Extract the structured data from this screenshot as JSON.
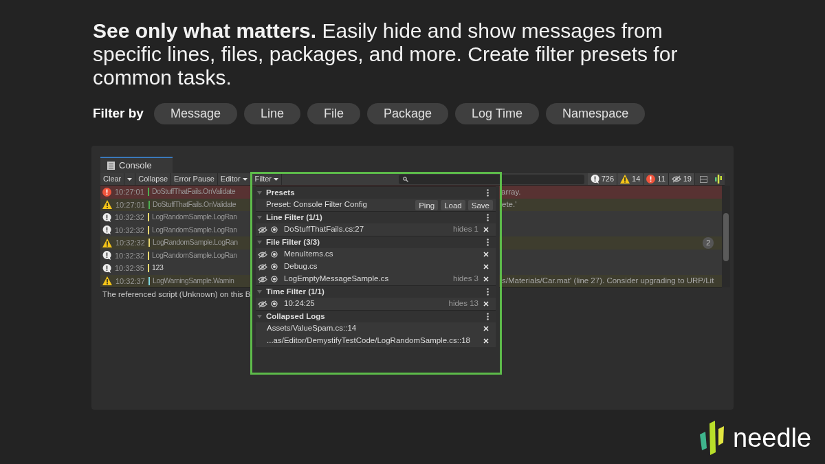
{
  "headline": "**See only what matters.** Easily hide and show messages from specific lines, files, packages, and more. Create filter presets for common tasks.",
  "filter_by": {
    "label": "Filter by",
    "chips": [
      "Message",
      "Line",
      "File",
      "Package",
      "Log Time",
      "Namespace"
    ]
  },
  "console": {
    "tab": "Console",
    "toolbar": {
      "buttons": [
        "Clear",
        "Collapse",
        "Error Pause",
        "Editor"
      ],
      "filter": "Filter",
      "counters": [
        {
          "kind": "info",
          "count": "726"
        },
        {
          "kind": "warning",
          "count": "14"
        },
        {
          "kind": "error",
          "count": "11"
        },
        {
          "kind": "hidden",
          "count": "19"
        }
      ]
    },
    "rows": [
      {
        "kind": "error",
        "time": "10:27:01",
        "color": "#4caf50",
        "message": "DoStuffThatFails.OnValidate",
        "tail": "array."
      },
      {
        "kind": "warning",
        "time": "10:27:01",
        "color": "#4caf50",
        "message": "DoStuffThatFails.OnValidate",
        "tail": "ete.'"
      },
      {
        "kind": "info",
        "time": "10:32:32",
        "color": "#e8d870",
        "message": "LogRandomSample.LogRan"
      },
      {
        "kind": "info",
        "time": "10:32:32",
        "color": "#e8d870",
        "message": "LogRandomSample.LogRan"
      },
      {
        "kind": "warning",
        "time": "10:32:32",
        "color": "#e8d870",
        "message": "LogRandomSample.LogRan",
        "badge": "2"
      },
      {
        "kind": "info",
        "time": "10:32:32",
        "color": "#e8d870",
        "message": "LogRandomSample.LogRan"
      },
      {
        "kind": "info",
        "time": "10:32:35",
        "color": "#e8d870",
        "message": "123"
      },
      {
        "kind": "warning",
        "time": "10:32:37",
        "color": "#7fd8e0",
        "message": "LogWarningSample.Warnin",
        "tail": "s/Materials/Car.mat' (line 27). Consider upgrading to URP/Lit"
      }
    ],
    "detail": "The referenced script (Unknown) on this B",
    "filter_popup": {
      "sections": [
        {
          "kind": "preset",
          "title": "Presets",
          "preset": "Preset: Console Filter Config",
          "buttons": [
            "Ping",
            "Load",
            "Save"
          ]
        },
        {
          "kind": "filter",
          "title": "Line Filter (1/1)",
          "items": [
            {
              "label": "DoStuffThatFails.cs:27",
              "hides": "hides 1"
            }
          ]
        },
        {
          "kind": "filter",
          "title": "File Filter (3/3)",
          "items": [
            {
              "label": "MenuItems.cs"
            },
            {
              "label": "Debug.cs"
            },
            {
              "label": "LogEmptyMessageSample.cs",
              "hides": "hides 3"
            }
          ]
        },
        {
          "kind": "filter",
          "title": "Time Filter (1/1)",
          "items": [
            {
              "label": "10:24:25",
              "hides": "hides 13"
            }
          ]
        },
        {
          "kind": "collapsed",
          "title": "Collapsed Logs",
          "items": [
            {
              "label": "Assets/ValueSpam.cs::14"
            },
            {
              "label": "...as/Editor/DemystifyTestCode/LogRandomSample.cs::18"
            }
          ]
        }
      ]
    }
  },
  "brand": "needle"
}
